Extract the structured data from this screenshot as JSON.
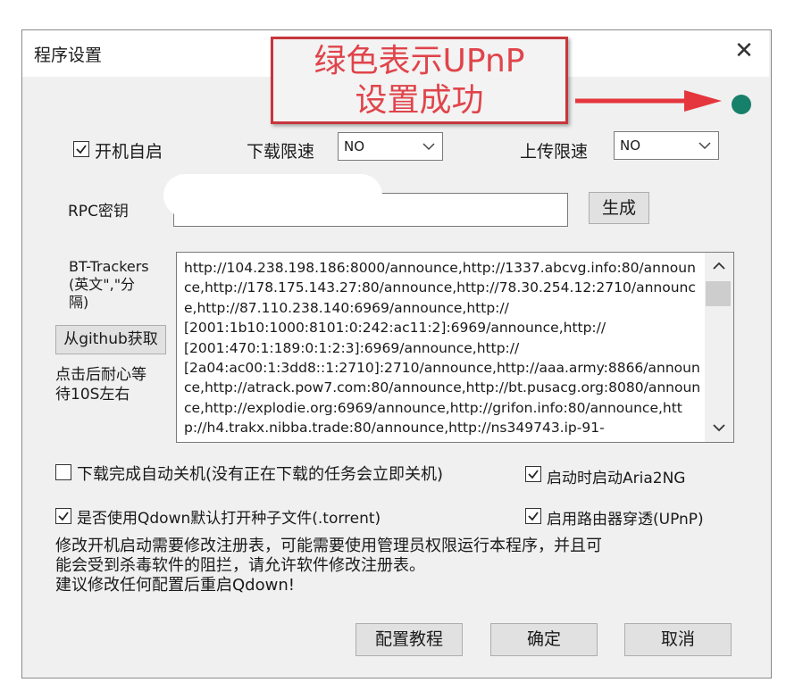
{
  "window": {
    "title": "程序设置",
    "close_glyph": "✕"
  },
  "callout": {
    "line1": "绿色表示UPnP",
    "line2": "设置成功",
    "color": "#c8363b"
  },
  "status_dot": {
    "color": "#17806a",
    "icon": "upnp-status-dot"
  },
  "startup": {
    "label": "开机自启",
    "checked": true
  },
  "download_limit": {
    "label": "下载限速",
    "value": "NO"
  },
  "upload_limit": {
    "label": "上传限速",
    "value": "NO"
  },
  "rpc": {
    "label": "RPC密钥",
    "value": "",
    "generate_label": "生成"
  },
  "trackers": {
    "label": "BT-Trackers\n(英文\",\"分\n隔)",
    "fetch_label": "从github获取",
    "fetch_hint": "点击后耐心等\n待10S左右",
    "text": "http://104.238.198.186:8000/announce,http://1337.abcvg.info:80/announce,http://178.175.143.27:80/announce,http://78.30.254.12:2710/announce,http://87.110.238.140:6969/announce,http://\n[2001:1b10:1000:8101:0:242:ac11:2]:6969/announce,http://\n[2001:470:1:189:0:1:2:3]:6969/announce,http://\n[2a04:ac00:1:3dd8::1:2710]:2710/announce,http://aaa.army:8866/announce,http://atrack.pow7.com:80/announce,http://bt.pusacg.org:8080/announce,http://explodie.org:6969/announce,http://grifon.info:80/announce,http://h4.trakx.nibba.trade:80/announce,http://ns349743.ip-91-"
  },
  "options": {
    "auto_shutdown": {
      "label": "下载完成自动关机(没有正在下载的任务会立即关机)",
      "checked": false
    },
    "start_aria2ng": {
      "label": "启动时启动Aria2NG",
      "checked": true
    },
    "default_torrent": {
      "label": "是否使用Qdown默认打开种子文件(.torrent)",
      "checked": true
    },
    "upnp": {
      "label": "启用路由器穿透(UPnP)",
      "checked": true
    }
  },
  "note": "修改开机启动需要修改注册表，可能需要使用管理员权限运行本程序，并且可\n能会受到杀毒软件的阻拦，请允许软件修改注册表。\n建议修改任何配置后重启Qdown!",
  "buttons": {
    "tutorial": "配置教程",
    "ok": "确定",
    "cancel": "取消"
  }
}
